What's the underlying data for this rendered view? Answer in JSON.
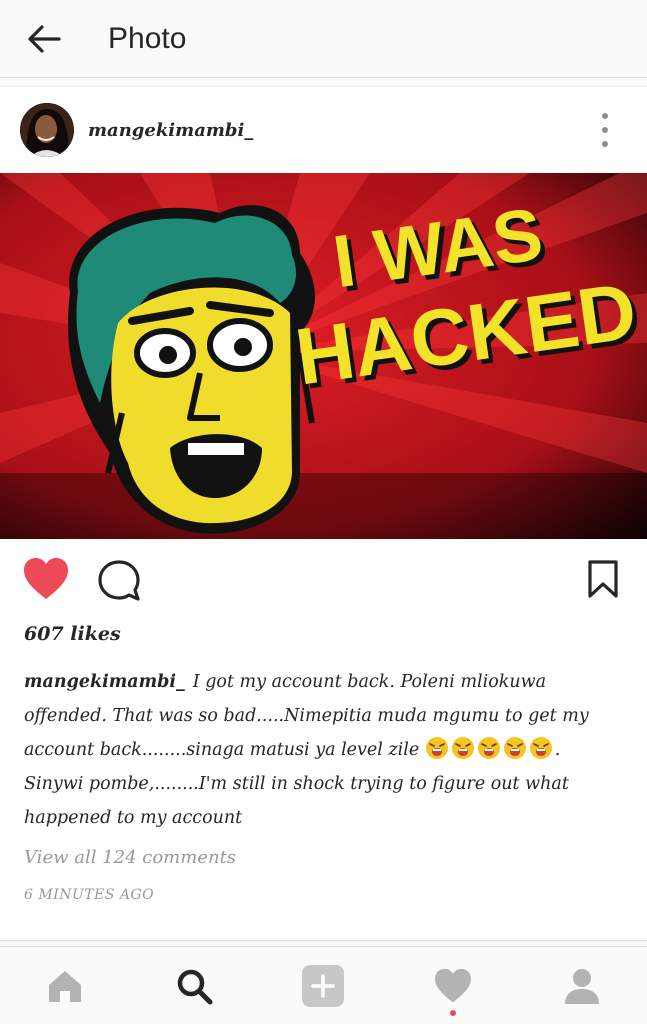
{
  "header": {
    "title": "Photo",
    "back_icon": "arrow-left-icon"
  },
  "post": {
    "username": "mangekimambi_",
    "avatar_icon": "profile-photo",
    "more_icon": "more-vertical-icon",
    "image": {
      "headline_line1": "I WAS",
      "headline_line2": "HACKED",
      "background_color": "#c8141e",
      "headline_color": "#f2e22a",
      "face_color": "#f0dc2a",
      "hair_color": "#1f8a78"
    },
    "actions": {
      "like_icon": "heart-filled-icon",
      "like_color": "#ed4956",
      "comment_icon": "comment-bubble-icon",
      "save_icon": "bookmark-icon",
      "liked": true
    },
    "likes_text": "607 likes",
    "caption": {
      "username": "mangekimambi_",
      "text_part1": "I got my account back. Poleni mliokuwa offended. That was so bad.....Nimepitia muda mgumu to get my account back........sinaga matusi ya level zile",
      "emoji_icon": "tired-face-emoji",
      "emoji_count": 5,
      "text_part2": ". Sinywi pombe,........I'm still in shock trying to figure out what happened to my account"
    },
    "view_comments": "View all 124 comments",
    "timestamp": "6 MINUTES AGO"
  },
  "bottom_nav": {
    "items": [
      {
        "name": "home",
        "icon": "home-icon",
        "active": false
      },
      {
        "name": "search",
        "icon": "search-icon",
        "active": true
      },
      {
        "name": "add",
        "icon": "add-post-icon",
        "active": false
      },
      {
        "name": "activity",
        "icon": "heart-icon",
        "active": false,
        "badge_color": "#ed4956"
      },
      {
        "name": "profile",
        "icon": "profile-icon",
        "active": false
      }
    ]
  }
}
